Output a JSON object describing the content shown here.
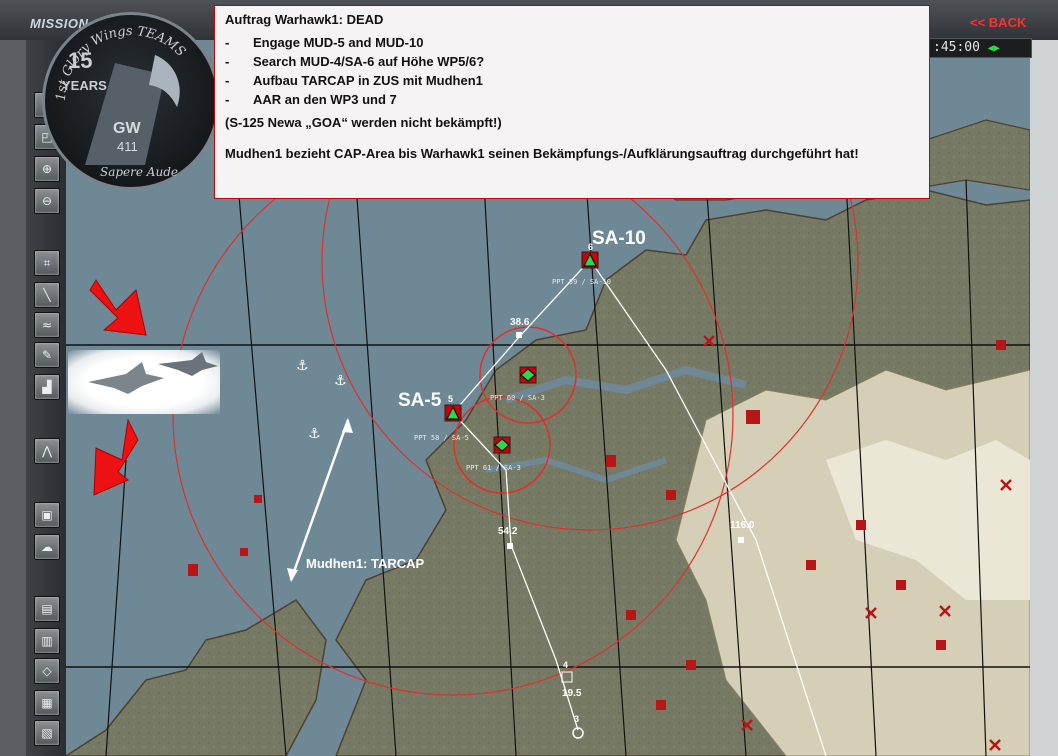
{
  "header": {
    "mission_label": "MISSION",
    "back_label": "<< BACK",
    "timer": ":45:00"
  },
  "logo": {
    "text": "1st Glory Wings TEAMS",
    "years_number": "15",
    "years_label": "YEARS",
    "motto": "Sapere Aude",
    "tail_code": "GW",
    "tail_number": "411"
  },
  "briefing": {
    "title": "Auftrag Warhawk1: DEAD",
    "tasks": [
      "Engage MUD-5 and MUD-10",
      "Search MUD-4/SA-6 auf Höhe WP5/6?",
      "Aufbau TARCAP in ZUS mit Mudhen1",
      "AAR an den WP3 und 7"
    ],
    "note": "(S-125 Newa „GOA“ werden nicht bekämpft!)",
    "footer": "Mudhen1 bezieht CAP-Area bis Warhawk1 seinen Bekämpfungs-/Aufklärungsauftrag durchgeführt hat!"
  },
  "map": {
    "labels": {
      "sa10": "SA-10",
      "sa5": "SA-5",
      "tarcap": "Mudhen1: TARCAP"
    },
    "sa10_sub": "PPT 59 / SA-10",
    "sa5_sub1": "PPT 58 / SA-5",
    "sa5_sub2": "PPT 61 / SA-3",
    "sa3_sub": "PPT 60 / SA-3",
    "waypoints": [
      "6",
      "5",
      "4",
      "3"
    ],
    "altitudes": [
      "38.6",
      "54.2",
      "116.0",
      "19.5"
    ],
    "colors": {
      "water": "#6f8896",
      "land_low": "#767a64",
      "land_high": "#d4cfb6",
      "threat_ring": "#e0302a",
      "route": "#ffffff",
      "callout_arrow": "#ee1111"
    }
  }
}
